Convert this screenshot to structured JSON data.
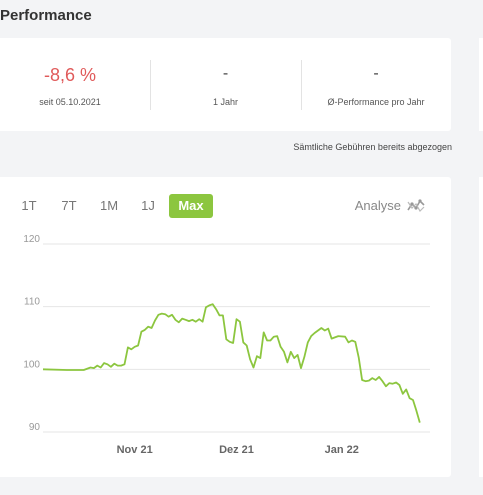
{
  "page": {
    "title": "Performance"
  },
  "stats": [
    {
      "value": "-8,6 %",
      "label": "seit 05.10.2021"
    },
    {
      "value": "-",
      "label": "1 Jahr"
    },
    {
      "value": "-",
      "label": "Ø-Performance pro Jahr"
    }
  ],
  "fee_note": "Sämtliche Gebühren bereits abgezogen",
  "range_tabs": [
    "1T",
    "7T",
    "1M",
    "1J",
    "Max"
  ],
  "active_range": "Max",
  "analyse": {
    "label": "Analyse",
    "icon": "chart-trend-icon"
  },
  "colors": {
    "accent": "#8cc63f",
    "negative": "#e05a5a",
    "line": "#8cc63f"
  },
  "chart_data": {
    "type": "line",
    "title": "",
    "xlabel": "",
    "ylabel": "",
    "ylim": [
      90,
      120
    ],
    "y_ticks": [
      90,
      100,
      110,
      120
    ],
    "x_tick_labels": [
      {
        "label": "Nov 21",
        "x": "2021-11-01"
      },
      {
        "label": "Dez 21",
        "x": "2021-12-01"
      },
      {
        "label": "Jan 22",
        "x": "2022-01-01"
      }
    ],
    "xlim": [
      "2021-10-05",
      "2022-01-27"
    ],
    "grid": true,
    "series": [
      {
        "points": [
          [
            "2021-10-05",
            100.0
          ],
          [
            "2021-10-12",
            99.9
          ],
          [
            "2021-10-17",
            99.9
          ],
          [
            "2021-10-19",
            100.3
          ],
          [
            "2021-10-20",
            100.2
          ],
          [
            "2021-10-21",
            100.6
          ],
          [
            "2021-10-22",
            100.3
          ],
          [
            "2021-10-23",
            101.0
          ],
          [
            "2021-10-24",
            100.8
          ],
          [
            "2021-10-25",
            100.4
          ],
          [
            "2021-10-26",
            100.9
          ],
          [
            "2021-10-27",
            100.6
          ],
          [
            "2021-10-28",
            100.6
          ],
          [
            "2021-10-29",
            100.8
          ],
          [
            "2021-10-30",
            103.5
          ],
          [
            "2021-10-31",
            103.2
          ],
          [
            "2021-11-01",
            103.6
          ],
          [
            "2021-11-02",
            103.8
          ],
          [
            "2021-11-03",
            106.0
          ],
          [
            "2021-11-04",
            106.3
          ],
          [
            "2021-11-05",
            106.8
          ],
          [
            "2021-11-06",
            106.6
          ],
          [
            "2021-11-07",
            107.8
          ],
          [
            "2021-11-08",
            108.7
          ],
          [
            "2021-11-09",
            108.9
          ],
          [
            "2021-11-10",
            108.8
          ],
          [
            "2021-11-11",
            108.4
          ],
          [
            "2021-11-12",
            108.7
          ],
          [
            "2021-11-13",
            107.9
          ],
          [
            "2021-11-14",
            107.5
          ],
          [
            "2021-11-15",
            108.1
          ],
          [
            "2021-11-16",
            107.9
          ],
          [
            "2021-11-17",
            107.7
          ],
          [
            "2021-11-18",
            107.9
          ],
          [
            "2021-11-19",
            107.6
          ],
          [
            "2021-11-20",
            108.0
          ],
          [
            "2021-11-21",
            107.6
          ],
          [
            "2021-11-22",
            109.9
          ],
          [
            "2021-11-23",
            110.2
          ],
          [
            "2021-11-24",
            110.4
          ],
          [
            "2021-11-25",
            109.6
          ],
          [
            "2021-11-26",
            108.6
          ],
          [
            "2021-11-27",
            108.6
          ],
          [
            "2021-11-28",
            104.8
          ],
          [
            "2021-11-29",
            104.4
          ],
          [
            "2021-11-30",
            104.2
          ],
          [
            "2021-12-01",
            108.0
          ],
          [
            "2021-12-02",
            107.6
          ],
          [
            "2021-12-03",
            104.3
          ],
          [
            "2021-12-04",
            103.8
          ],
          [
            "2021-12-05",
            101.6
          ],
          [
            "2021-12-06",
            100.3
          ],
          [
            "2021-12-07",
            102.1
          ],
          [
            "2021-12-08",
            101.8
          ],
          [
            "2021-12-09",
            105.9
          ],
          [
            "2021-12-10",
            104.6
          ],
          [
            "2021-12-11",
            104.6
          ],
          [
            "2021-12-12",
            105.2
          ],
          [
            "2021-12-13",
            105.3
          ],
          [
            "2021-12-14",
            103.6
          ],
          [
            "2021-12-15",
            102.8
          ],
          [
            "2021-12-16",
            101.1
          ],
          [
            "2021-12-17",
            102.8
          ],
          [
            "2021-12-18",
            101.8
          ],
          [
            "2021-12-19",
            102.3
          ],
          [
            "2021-12-20",
            100.2
          ],
          [
            "2021-12-21",
            102.0
          ],
          [
            "2021-12-22",
            104.3
          ],
          [
            "2021-12-23",
            105.3
          ],
          [
            "2021-12-24",
            105.8
          ],
          [
            "2021-12-25",
            106.2
          ],
          [
            "2021-12-26",
            106.6
          ],
          [
            "2021-12-27",
            106.2
          ],
          [
            "2021-12-28",
            106.5
          ],
          [
            "2021-12-29",
            104.9
          ],
          [
            "2021-12-30",
            105.1
          ],
          [
            "2021-12-31",
            105.3
          ],
          [
            "2022-01-02",
            105.2
          ],
          [
            "2022-01-03",
            104.3
          ],
          [
            "2022-01-04",
            104.6
          ],
          [
            "2022-01-05",
            104.4
          ],
          [
            "2022-01-06",
            101.9
          ],
          [
            "2022-01-07",
            98.3
          ],
          [
            "2022-01-08",
            98.1
          ],
          [
            "2022-01-09",
            98.2
          ],
          [
            "2022-01-10",
            98.6
          ],
          [
            "2022-01-11",
            98.3
          ],
          [
            "2022-01-12",
            98.8
          ],
          [
            "2022-01-13",
            98.1
          ],
          [
            "2022-01-14",
            97.3
          ],
          [
            "2022-01-15",
            97.8
          ],
          [
            "2022-01-16",
            97.7
          ],
          [
            "2022-01-17",
            97.9
          ],
          [
            "2022-01-18",
            97.5
          ],
          [
            "2022-01-19",
            96.1
          ],
          [
            "2022-01-20",
            96.8
          ],
          [
            "2022-01-21",
            95.4
          ],
          [
            "2022-01-22",
            95.1
          ],
          [
            "2022-01-23",
            93.4
          ],
          [
            "2022-01-24",
            91.5
          ]
        ]
      }
    ]
  }
}
